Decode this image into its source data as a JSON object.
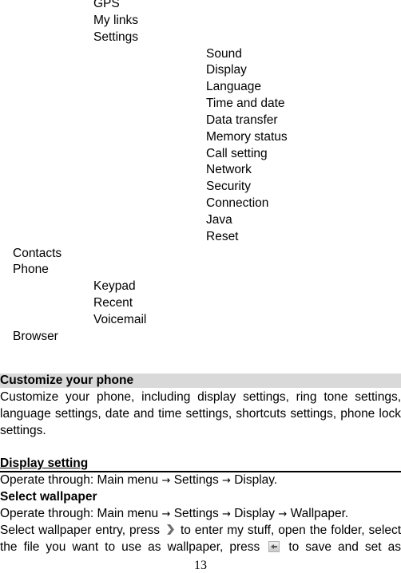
{
  "menu_tree": {
    "phone_menu_subitems": [
      "GPS",
      "My links",
      "Settings"
    ],
    "settings_subitems": [
      "Sound",
      "Display",
      "Language",
      "Time and date",
      "Data transfer",
      "Memory status",
      "Call setting",
      "Network",
      "Security",
      "Connection",
      "Java",
      "Reset"
    ],
    "contacts": "Contacts",
    "phone": "Phone",
    "phone_subitems": [
      "Keypad",
      "Recent",
      "Voicemail"
    ],
    "browser": "Browser"
  },
  "customize_section": {
    "heading": "Customize your phone",
    "line1": "Customize your phone, including display settings, ring tone settings,",
    "line2": "language settings, date and time settings, shortcuts settings, phone lock",
    "line3": "settings."
  },
  "display_section": {
    "heading": "Display setting",
    "operate_prefix": "Operate through: Main menu ",
    "arrow": "→",
    "path1": " Settings ",
    "path2": " Display.",
    "wallpaper_heading": "Select wallpaper",
    "wp_operate_prefix": "Operate through: Main menu ",
    "wp_path1": " Settings ",
    "wp_path2": " Display ",
    "wp_path3": " Wallpaper.",
    "wp_text1_a": "Select wallpaper entry, press",
    "wp_text1_b": "to enter my stuff, open the folder, select",
    "wp_text2_a": "the file you want to use as wallpaper, press",
    "wp_text2_b": "to save and set as",
    "icons": {
      "enter": "chevron-right-icon",
      "save": "back-arrow-icon"
    }
  },
  "page_number": "13"
}
